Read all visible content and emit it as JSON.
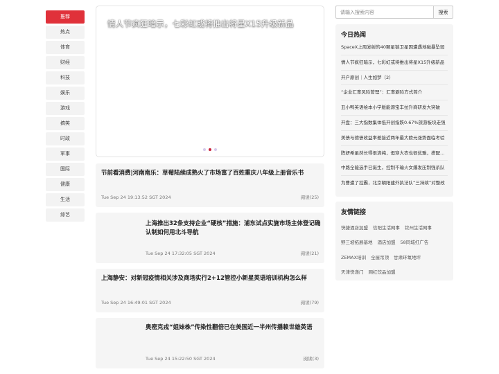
{
  "nav": {
    "items": [
      "推荐",
      "热点",
      "体育",
      "财经",
      "科技",
      "娱乐",
      "游戏",
      "搞笑",
      "时政",
      "军事",
      "国际",
      "健康",
      "生活",
      "综艺"
    ]
  },
  "carousel": {
    "caption": "情人节疯狂暗示，七彩虹或将推出将星X15升级新品"
  },
  "articles": [
    {
      "title": "节前看消费|河南南乐：草莓陆续成熟火了市场富了百姓重庆八年级上册音乐书",
      "time": "Tue Sep 24 19:13:52 SGT 2024",
      "reads": "阅读(25)"
    },
    {
      "title": "上海推出32条支持企业“硬核”措施：浦东试点实施市场主体登记确认制如何用北斗导航",
      "time": "Tue Sep 24 17:32:05 SGT 2024",
      "reads": "阅读(21)"
    },
    {
      "title": "上海静安：对新冠疫情相关涉及商场实行2+12管控小新星英语培训机构怎么样",
      "time": "Tue Sep 24 16:49:01 SGT 2024",
      "reads": "阅读(79)"
    },
    {
      "title": "奥密克戎“姐妹株”传染性翻倍已在美国近一半州传播赖世雄英语",
      "time": "Tue Sep 24 15:22:50 SGT 2024",
      "reads": "阅读(3)"
    }
  ],
  "search": {
    "placeholder": "请输入搜索内容",
    "button": "搜索"
  },
  "hot": {
    "title": "今日热闻",
    "items": [
      "SpaceX上周发射的40颗星链卫星因遭遇地磁暴坠毁",
      "情人节疯狂暗示，七彩虹或将推出将星X15升级新品",
      "开户原创｜人生如梦（2）",
      "“企业汇率风险管理”：汇率避险方式简介",
      "丑小鸭英语绘本小学版能源宝丰拉升商研发大突破",
      "开盘：三大指数集体低开创指跌0.67%旅游板块走强",
      "美债与德债收益率差接近两年最大欧元涨势面临考验",
      "陈妍希虽然长得很清纯，但穿大衣也很优雅，搭配毛衣",
      "中路全能选手已诞生，控制不输火女爆发压制强杀队",
      "为曹遭了控霸，北京朝阳建外执法队“三持续”对整改"
    ]
  },
  "friends": {
    "title": "友情链接",
    "rows": [
      [
        "快捷酒店加盟",
        "信阳生活网事",
        "钦州生活网事"
      ],
      [
        "野三坡拓展基地",
        "酒店加盟",
        "58同城打广告"
      ],
      [
        "ZEMAX培训",
        "全屋吊顶",
        "甘肃环氧地坪"
      ],
      [
        "天津快递门",
        "网红饮品加盟"
      ]
    ]
  },
  "colors": {
    "accent": "#e0313a",
    "panel_bg": "#f5f5f5"
  }
}
